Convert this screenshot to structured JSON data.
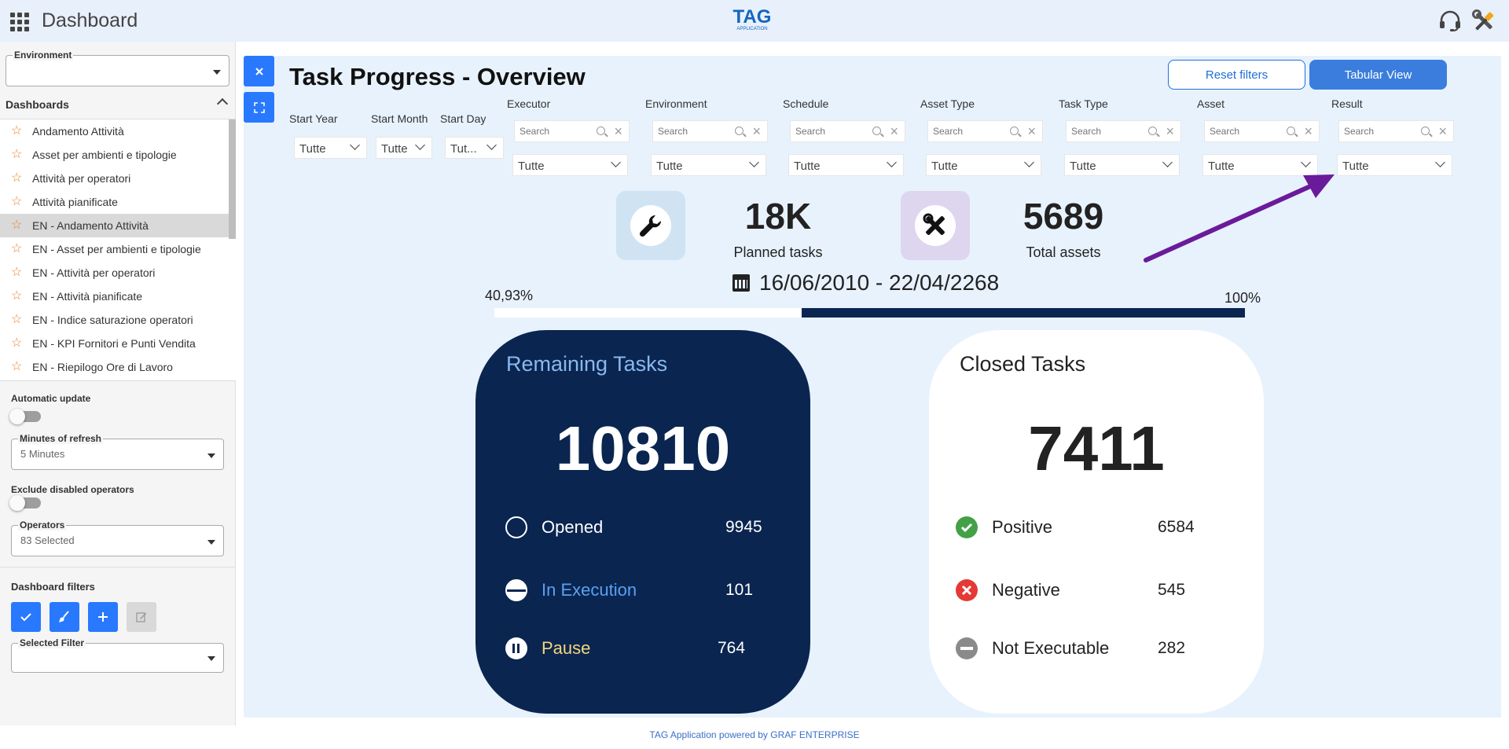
{
  "header": {
    "title": "Dashboard",
    "logo_main": "TAG",
    "logo_sub": "APPLICATION"
  },
  "sidebar": {
    "environment_label": "Environment",
    "environment_value": "",
    "dashboards_label": "Dashboards",
    "items": [
      {
        "label": "Andamento Attività"
      },
      {
        "label": "Asset per ambienti e tipologie"
      },
      {
        "label": "Attività per operatori"
      },
      {
        "label": "Attività pianificate"
      },
      {
        "label": "EN - Andamento Attività"
      },
      {
        "label": "EN - Asset per ambienti e tipologie"
      },
      {
        "label": "EN - Attività per operatori"
      },
      {
        "label": "EN - Attività pianificate"
      },
      {
        "label": "EN - Indice saturazione operatori"
      },
      {
        "label": "EN - KPI Fornitori e Punti Vendita"
      },
      {
        "label": "EN - Riepilogo Ore di Lavoro"
      }
    ],
    "active_index": 4,
    "automatic_update_label": "Automatic update",
    "minutes_label": "Minutes of refresh",
    "minutes_value": "5 Minutes",
    "exclude_label": "Exclude disabled operators",
    "operators_label": "Operators",
    "operators_value": "83 Selected",
    "dashboard_filters_label": "Dashboard filters",
    "selected_filter_label": "Selected Filter",
    "selected_filter_value": ""
  },
  "main": {
    "title": "Task Progress - Overview",
    "reset_filters": "Reset filters",
    "tabular_view": "Tabular View",
    "date_filters": [
      {
        "label": "Start Year",
        "value": "Tutte"
      },
      {
        "label": "Start Month",
        "value": "Tutte"
      },
      {
        "label": "Start Day",
        "value": "Tut..."
      }
    ],
    "filters": [
      {
        "label": "Executor",
        "placeholder": "Search",
        "value": "Tutte"
      },
      {
        "label": "Environment",
        "placeholder": "Search",
        "value": "Tutte"
      },
      {
        "label": "Schedule",
        "placeholder": "Search",
        "value": "Tutte"
      },
      {
        "label": "Asset Type",
        "placeholder": "Search",
        "value": "Tutte"
      },
      {
        "label": "Task Type",
        "placeholder": "Search",
        "value": "Tutte"
      },
      {
        "label": "Asset",
        "placeholder": "Search",
        "value": "Tutte"
      },
      {
        "label": "Result",
        "placeholder": "Search",
        "value": "Tutte"
      }
    ],
    "kpis": {
      "planned_value": "18K",
      "planned_label": "Planned tasks",
      "assets_value": "5689",
      "assets_label": "Total assets"
    },
    "date_range": "16/06/2010 - 22/04/2268",
    "progress": {
      "left_label": "40,93%",
      "right_label": "100%",
      "fraction": 0.5907
    },
    "remaining": {
      "title": "Remaining Tasks",
      "total": "10810",
      "rows": [
        {
          "label": "Opened",
          "value": "9945"
        },
        {
          "label": "In Execution",
          "value": "101"
        },
        {
          "label": "Pause",
          "value": "764"
        }
      ]
    },
    "closed": {
      "title": "Closed Tasks",
      "total": "7411",
      "rows": [
        {
          "label": "Positive",
          "value": "6584"
        },
        {
          "label": "Negative",
          "value": "545"
        },
        {
          "label": "Not Executable",
          "value": "282"
        }
      ]
    }
  },
  "colors": {
    "primary": "#2979ff",
    "navy": "#0a2550",
    "panel_bg": "#e8f2fd",
    "star": "#e8842c",
    "arrow": "#6a1b9a",
    "execution": "#5aa0f2",
    "pause": "#f5d77a"
  },
  "footer": {
    "text": "TAG Application powered by GRAF ENTERPRISE"
  }
}
